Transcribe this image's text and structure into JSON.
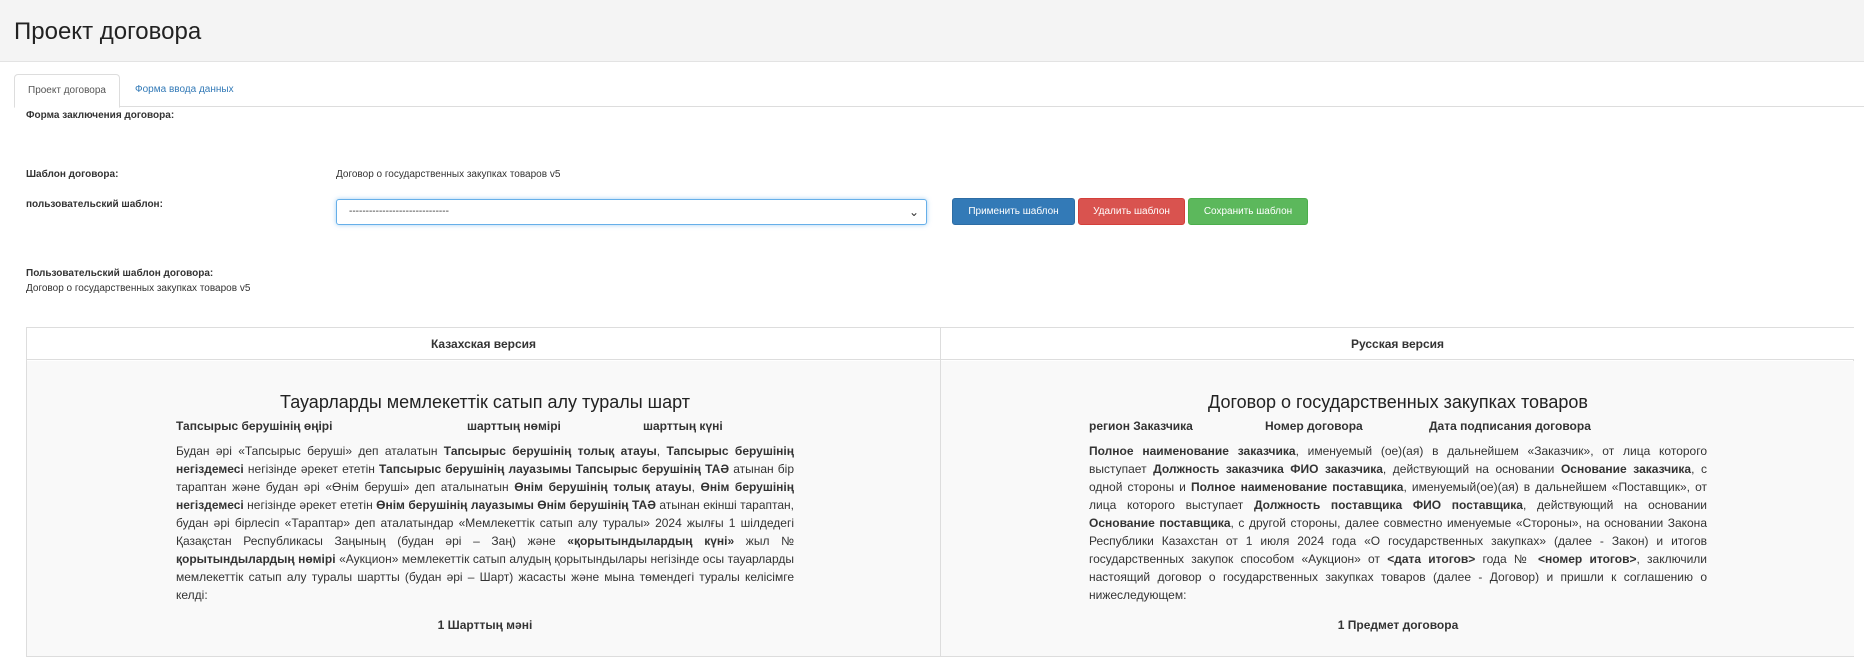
{
  "page": {
    "title": "Проект договора"
  },
  "tabs": {
    "active": "Проект договора",
    "other": "Форма ввода данных"
  },
  "form": {
    "conclusion_label": "Форма заключения договора:",
    "template_label": "Шаблон договора:",
    "template_value": "Договор о государственных закупках товаров v5",
    "user_template_label": "пользовательский шаблон:",
    "user_template_selected": "------------------------------",
    "apply_button": "Применить шаблон",
    "delete_button": "Удалить шаблон",
    "save_button": "Сохранить шаблон",
    "user_contract_label": "Пользовательский шаблон договора:",
    "user_contract_value": "Договор о государственных закупках товаров v5"
  },
  "colors": {
    "primary": "#337ab7",
    "danger": "#d9534f",
    "success": "#5cb85c"
  },
  "kz": {
    "header": "Казахская версия",
    "title": "Тауарларды мемлекеттік сатып алу туралы шарт",
    "meta": [
      "Тапсырыс берушінің өңірі",
      "шарттың нөмірі",
      "шарттың күні"
    ],
    "section": "1 Шарттың мәні"
  },
  "ru": {
    "header": "Русская версия",
    "title": "Договор о государственных закупках товаров",
    "meta": [
      "регион Заказчика",
      "Номер договора",
      "Дата подписания договора"
    ],
    "section": "1 Предмет договора"
  },
  "kz_para": [
    {
      "t": "Будан әрі «Тапсырыс беруші» деп аталатын ",
      "b": false
    },
    {
      "t": "Тапсырыс берушінің толық атауы",
      "b": true
    },
    {
      "t": ", ",
      "b": false
    },
    {
      "t": "Тапсырыс берушінің негіздемесі",
      "b": true
    },
    {
      "t": " негізінде әрекет ететін ",
      "b": false
    },
    {
      "t": "Тапсырыс берушінің лауазымы Тапсырыс берушінің ТАӘ",
      "b": true
    },
    {
      "t": " атынан бір тараптан және будан әрі «Өнім беруші» деп аталынатын ",
      "b": false
    },
    {
      "t": "Өнім берушінің толық атауы",
      "b": true
    },
    {
      "t": ", ",
      "b": false
    },
    {
      "t": "Өнім берушінің негіздемесі",
      "b": true
    },
    {
      "t": " негізінде әрекет ететін ",
      "b": false
    },
    {
      "t": "Өнім берушінің лауазымы Өнім берушінің ТАӘ",
      "b": true
    },
    {
      "t": " атынан екінші тараптан, будан әрі бірлесіп «Тараптар» деп аталатындар «Мемлекеттік сатып алу туралы» 2024 жылғы 1 шілдедегі Қазақстан Республикасы Заңының (будан әрі – Заң) және ",
      "b": false
    },
    {
      "t": "«қорытындылардың күні»",
      "b": true
    },
    {
      "t": " жыл № ",
      "b": false
    },
    {
      "t": "қорытындылардың нөмірі",
      "b": true
    },
    {
      "t": " «Аукцион» мемлекеттік сатып алудың қорытындылары негізінде осы тауарларды мемлекеттік сатып алу туралы шартты (будан әрі – Шарт) жасасты және мына төмендегі туралы келісімге келді:",
      "b": false
    }
  ],
  "ru_para": [
    {
      "t": "Полное наименование заказчика",
      "b": true
    },
    {
      "t": ", именуемый (ое)(ая) в дальнейшем «Заказчик», от лица которого выступает ",
      "b": false
    },
    {
      "t": "Должность заказчика ФИО заказчика",
      "b": true
    },
    {
      "t": ", действующий на основании ",
      "b": false
    },
    {
      "t": "Основание заказчика",
      "b": true
    },
    {
      "t": ", с одной стороны и ",
      "b": false
    },
    {
      "t": "Полное наименование поставщика",
      "b": true
    },
    {
      "t": ", именуемый(ое)(ая) в дальнейшем «Поставщик», от лица которого выступает ",
      "b": false
    },
    {
      "t": "Должность поставщика ФИО поставщика",
      "b": true
    },
    {
      "t": ", действующий на основании ",
      "b": false
    },
    {
      "t": "Основание поставщика",
      "b": true
    },
    {
      "t": ", с другой стороны, далее совместно именуемые «Стороны», на основании Закона Республики Казахстан от 1 июля 2024 года «О государственных закупках» (далее - Закон) и итогов государственных закупок способом «Аукцион» от ",
      "b": false
    },
    {
      "t": "<дата итогов>",
      "b": true
    },
    {
      "t": " года № ",
      "b": false
    },
    {
      "t": "<номер итогов>",
      "b": true
    },
    {
      "t": ", заключили настоящий договор о государственных закупках товаров (далее - Договор) и пришли к соглашению о нижеследующем:",
      "b": false
    }
  ]
}
